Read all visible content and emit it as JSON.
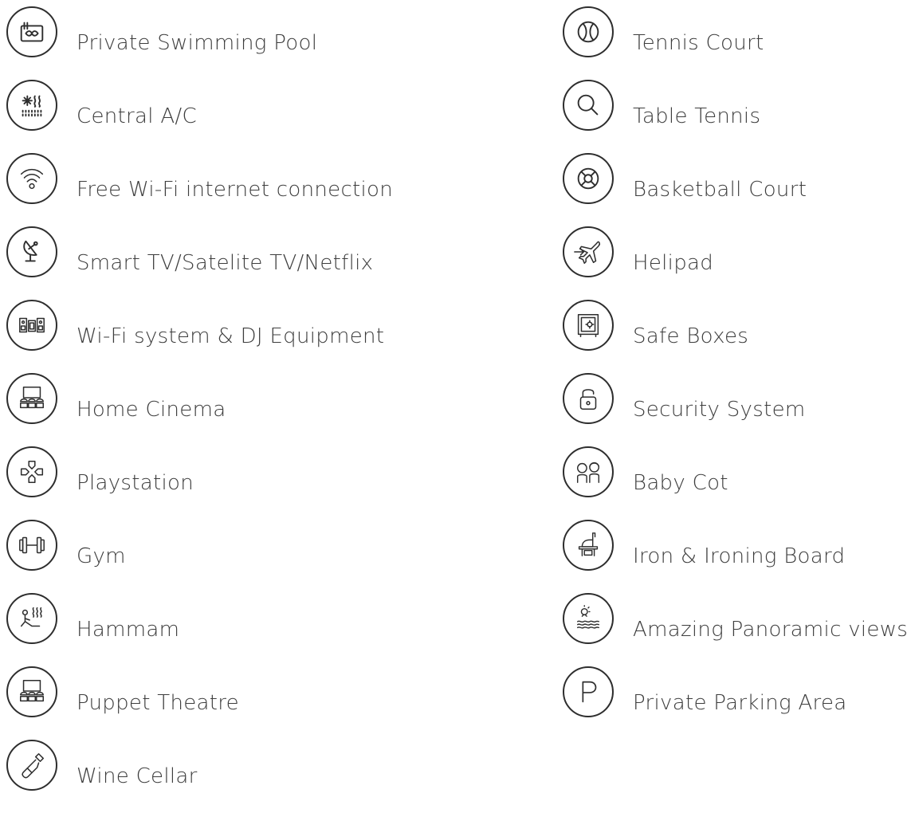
{
  "left_column": [
    {
      "label": "Private Swimming Pool",
      "icon": "pool-icon"
    },
    {
      "label": "Central A/C",
      "icon": "air-conditioning-icon"
    },
    {
      "label": "Free Wi-Fi internet connection",
      "icon": "wifi-icon"
    },
    {
      "label": "Smart TV/Satelite TV/Netflix",
      "icon": "satellite-dish-icon"
    },
    {
      "label": "Wi-Fi system & DJ Equipment",
      "icon": "speakers-icon"
    },
    {
      "label": "Home Cinema",
      "icon": "cinema-icon"
    },
    {
      "label": "Playstation",
      "icon": "gamepad-icon"
    },
    {
      "label": "Gym",
      "icon": "dumbbell-icon"
    },
    {
      "label": "Hammam",
      "icon": "hammam-icon"
    },
    {
      "label": "Puppet Theatre",
      "icon": "theatre-icon"
    },
    {
      "label": "Wine Cellar",
      "icon": "wine-bottle-icon"
    }
  ],
  "right_column": [
    {
      "label": "Tennis Court",
      "icon": "tennis-ball-icon"
    },
    {
      "label": "Table Tennis",
      "icon": "ping-pong-icon"
    },
    {
      "label": "Basketball Court",
      "icon": "basketball-icon"
    },
    {
      "label": "Helipad",
      "icon": "airplane-icon"
    },
    {
      "label": "Safe Boxes",
      "icon": "safe-icon"
    },
    {
      "label": "Security System",
      "icon": "padlock-icon"
    },
    {
      "label": "Baby Cot",
      "icon": "children-icon"
    },
    {
      "label": "Iron & Ironing Board",
      "icon": "iron-icon"
    },
    {
      "label": "Amazing Panoramic views",
      "icon": "sea-view-icon"
    },
    {
      "label": "Private Parking Area",
      "icon": "parking-icon"
    }
  ]
}
